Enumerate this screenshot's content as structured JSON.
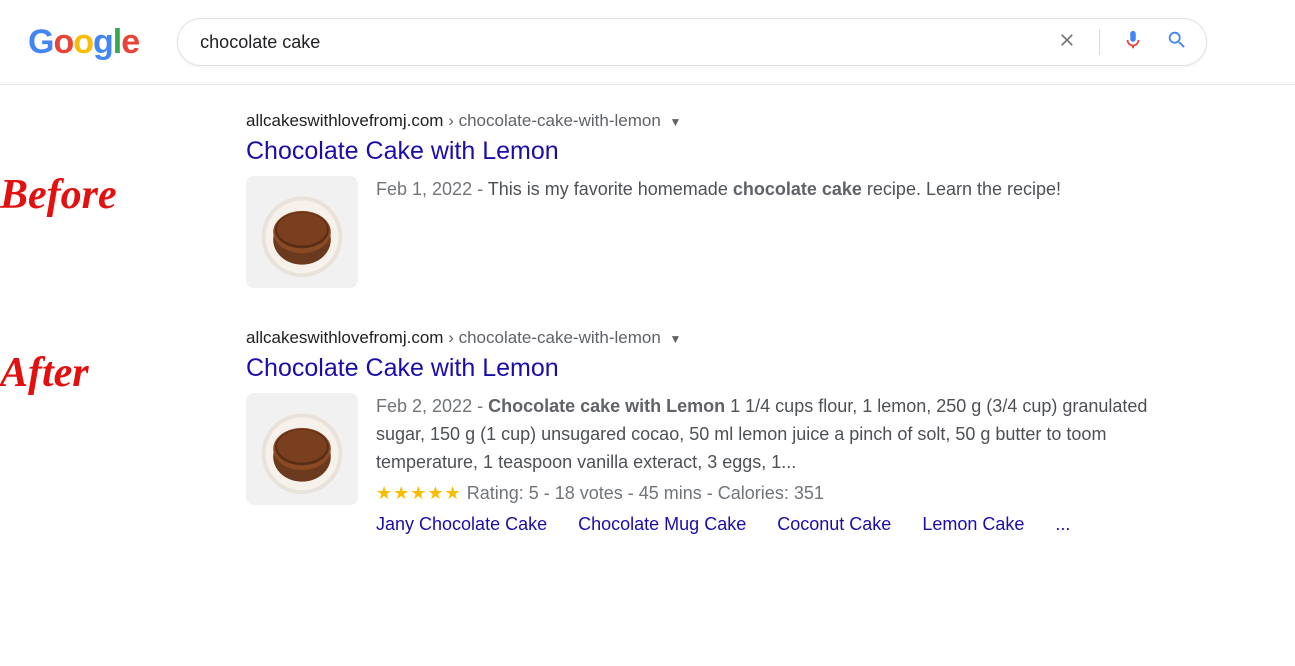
{
  "header": {
    "logo": "Google",
    "search_value": "chocolate cake",
    "clear_icon": "clear",
    "voice_icon": "voice",
    "search_icon": "search"
  },
  "side": {
    "before_label": "Before",
    "after_label": "After"
  },
  "result_before": {
    "domain": "allcakeswithlovefromj.com",
    "path": "chocolate-cake-with-lemon",
    "title": "Chocolate Cake with Lemon",
    "date": "Feb 1, 2022",
    "sep": " - ",
    "snippet_pre": "This is my favorite homemade ",
    "snippet_bold": "chocolate cake",
    "snippet_post": " recipe. Learn the recipe!"
  },
  "result_after": {
    "domain": "allcakeswithlovefromj.com",
    "path": "chocolate-cake-with-lemon",
    "title": "Chocolate Cake with Lemon",
    "date": "Feb 2, 2022",
    "sep": " -  ",
    "snippet_bold": "Chocolate cake with Lemon",
    "snippet_post": "  1  1/4 cups flour, 1 lemon, 250 g (3/4 cup) granulated sugar, 150 g (1 cup) unsugared cocao, 50 ml lemon juice  a pinch of solt, 50 g butter to toom temperature, 1 teaspoon vanilla exteract, 3 eggs, 1...",
    "stars": "★★★★★",
    "meta_text": " Rating: 5 - 18 votes - 45 mins - Calories: 351",
    "links": {
      "l1": "Jany Chocolate Cake",
      "l2": "Chocolate Mug Cake",
      "l3": "Coconut Cake",
      "l4": "Lemon Cake",
      "more": "..."
    }
  }
}
